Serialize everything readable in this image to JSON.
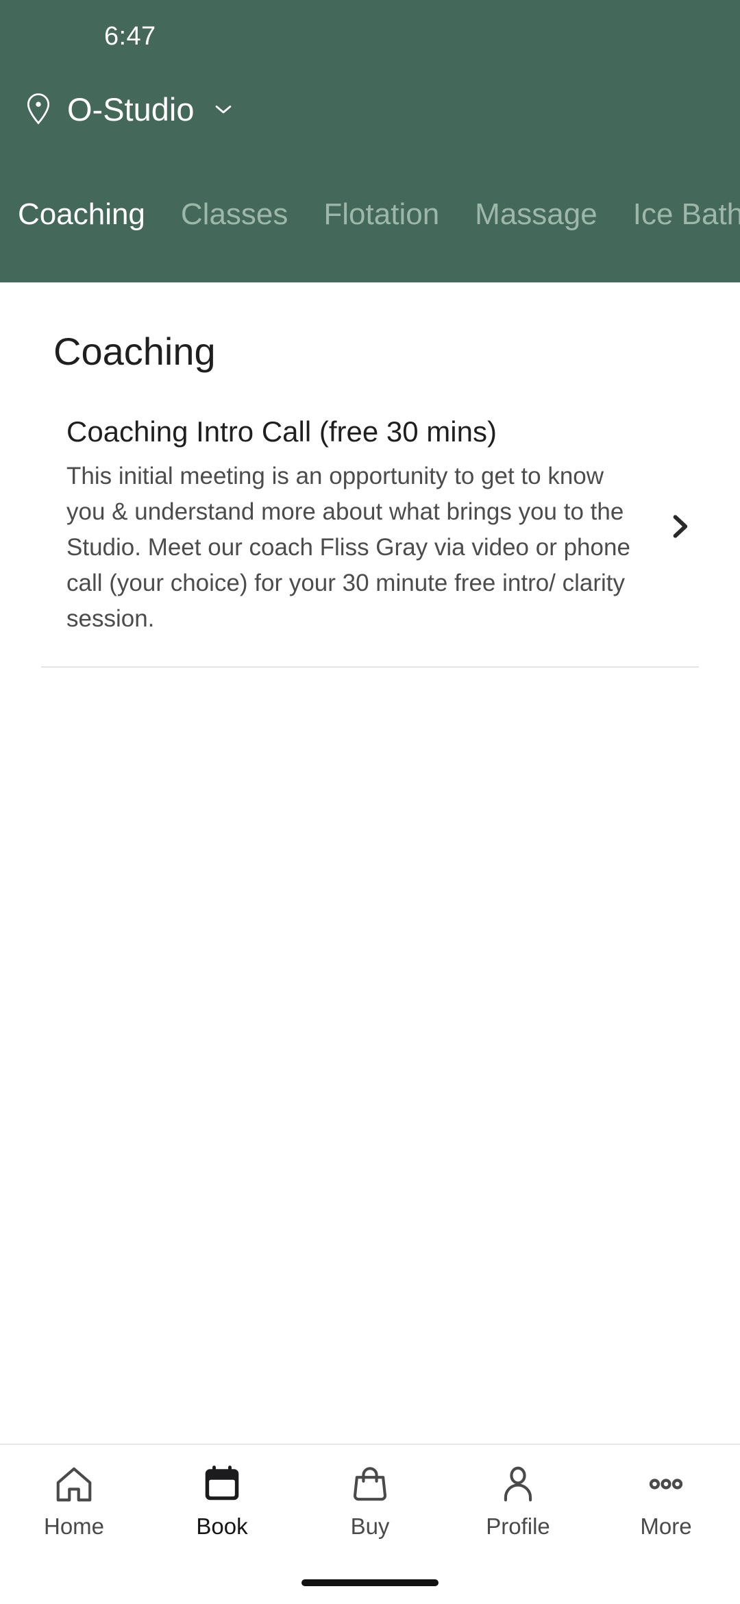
{
  "status_bar": {
    "time": "6:47"
  },
  "header": {
    "background_color": "#44695B",
    "location_icon": "map-pin-icon",
    "location_name": "O-Studio",
    "location_dropdown_icon": "chevron-down-icon",
    "tabs": [
      {
        "label": "Coaching",
        "active": true
      },
      {
        "label": "Classes",
        "active": false
      },
      {
        "label": "Flotation",
        "active": false
      },
      {
        "label": "Massage",
        "active": false
      },
      {
        "label": "Ice Bath",
        "active": false
      }
    ],
    "active_tab_color": "#FFFFFF",
    "inactive_tab_color": "#9DB7AB"
  },
  "main": {
    "page_title": "Coaching",
    "services": [
      {
        "title": "Coaching Intro Call (free 30 mins)",
        "description": "This initial meeting is an opportunity to get to know you & understand more about what brings you to the Studio. Meet our coach Fliss Gray via video or phone call (your choice) for your 30 minute free intro/ clarity session.",
        "chevron_icon": "chevron-right-icon"
      }
    ]
  },
  "bottom_nav": {
    "items": [
      {
        "label": "Home",
        "icon": "home-icon",
        "active": false
      },
      {
        "label": "Book",
        "icon": "calendar-icon",
        "active": true
      },
      {
        "label": "Buy",
        "icon": "shopping-bag-icon",
        "active": false
      },
      {
        "label": "Profile",
        "icon": "person-icon",
        "active": false
      },
      {
        "label": "More",
        "icon": "ellipsis-icon",
        "active": false
      }
    ]
  }
}
